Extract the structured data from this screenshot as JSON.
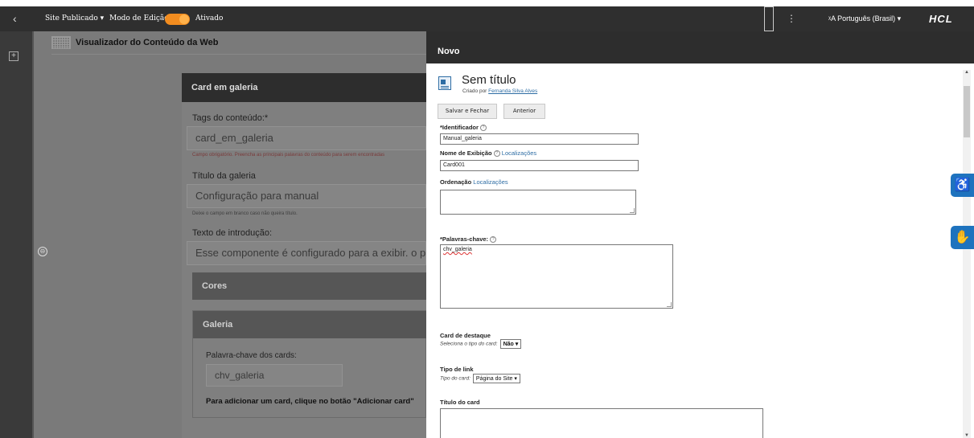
{
  "topbar": {
    "back_glyph": "‹",
    "site_status": "Site Publicado ▾",
    "edit_mode_label": "Modo de Edição:",
    "edit_mode_value": "Ativado",
    "menu_glyph": "⋮",
    "language": "ᵡA Português (Brasil) ▾",
    "brand": "HCL"
  },
  "content": {
    "header": "Visualizador do Conteúdo da Web",
    "card": {
      "title": "Card em galeria",
      "tags_label": "Tags do conteúdo:*",
      "tags_value": "card_em_galeria",
      "tags_hint": "Campo obrigatório. Preencha as principais palavras do conteúdo para serem encontradas",
      "gallery_title_label": "Título da galeria",
      "gallery_title_value": "Configuração para manual",
      "gallery_title_hint": "Deixe o campo em branco caso não queira título.",
      "intro_label": "Texto de introdução:",
      "intro_value": "Esse componente é configurado para a exibir. o passo a passo",
      "cores_label": "Cores",
      "galeria_label": "Galeria",
      "keyword_label": "Palavra-chave dos cards:",
      "keyword_value": "chv_galeria",
      "add_card_text": "Para adicionar um card, clique no botão \"Adicionar card\""
    }
  },
  "novo": {
    "header": "Novo",
    "doc_title": "Sem título",
    "created_by_prefix": "Criado por ",
    "created_by_name": "Fernanda Silva Alves",
    "save_close_button": "Salvar e Fechar",
    "previous_button": "Anterior",
    "identifier_label": "*Identificador",
    "identifier_value": "Manual_galeria",
    "display_name_label": "Nome de Exibição",
    "display_name_link": "Localizações",
    "display_name_value": "Card001",
    "ordering_label": "Ordenação",
    "ordering_link": "Localizações",
    "keywords_label": "*Palavras-chave:",
    "keywords_value": "chv_galeria",
    "featured_label": "Card de destaque",
    "featured_sub": "Seleciona o tipo do card:",
    "featured_select": "Não ▾",
    "link_type_label": "Tipo de link",
    "link_type_sub": "Tipo do card:",
    "link_type_select": "Página do Site   ▾",
    "card_title_label": "Título do card",
    "help_glyph": "?"
  },
  "floating": {
    "accessibility_glyph": "♿",
    "sign_language_glyph": "✋"
  }
}
